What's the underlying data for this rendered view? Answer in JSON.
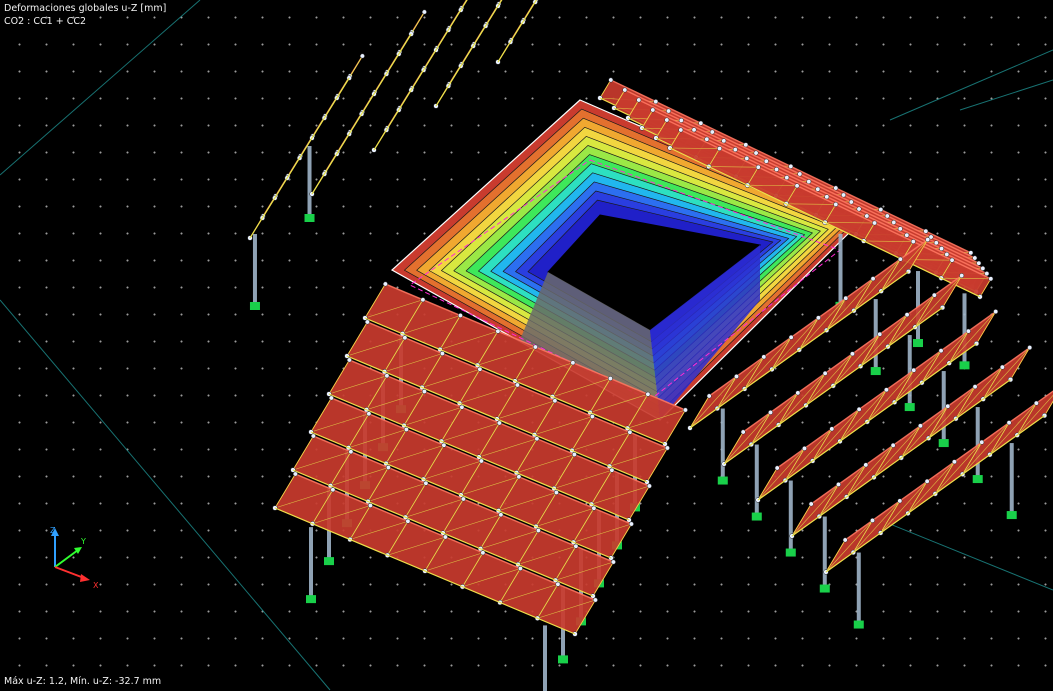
{
  "view": {
    "result_title": "Deformaciones globales u-Z [mm]",
    "combination": "CO2 : CC1 + CC2",
    "extremes": "Máx u-Z: 1.2, Mín. u-Z: -32.7 mm"
  },
  "axis_triad": {
    "x_label": "X",
    "y_label": "Y",
    "z_label": "Z",
    "x_color": "#ff3030",
    "y_color": "#30ff30",
    "z_color": "#30a0ff"
  },
  "colors": {
    "background": "#000000",
    "grid_dots": "#9a9a9a",
    "grid_lines": "#1e8f8f",
    "roof_fill": "#c93b2e",
    "truss": "#e8e34a",
    "column": "#9fb4c8",
    "support": "#19d04a",
    "node": "#e8f0ff",
    "contour_scale": [
      "#c93b2e",
      "#e3702e",
      "#f0a830",
      "#f2d640",
      "#d8e840",
      "#9ae846",
      "#3ee85a",
      "#2de0c0",
      "#21b7ee",
      "#2c6ff0",
      "#2a3ee0",
      "#2020c8"
    ]
  }
}
